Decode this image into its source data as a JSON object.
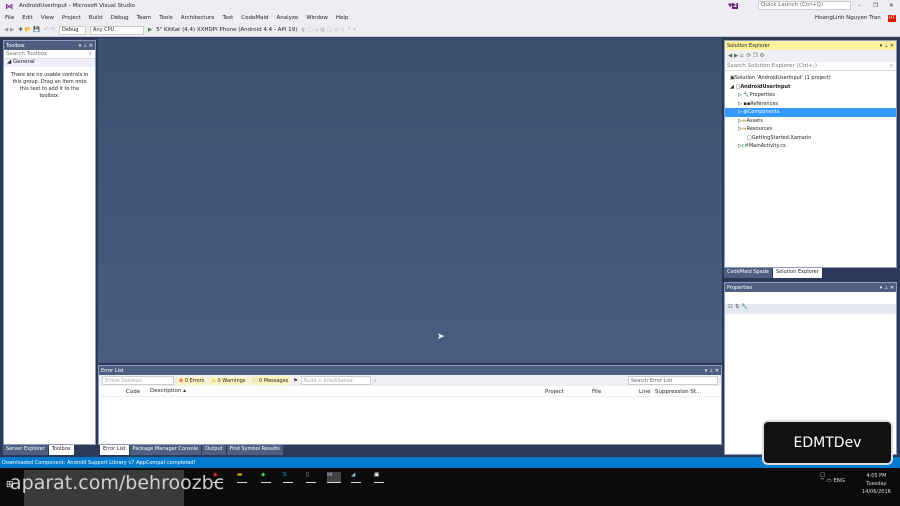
{
  "window": {
    "title": "AndroidUserInput - Microsoft Visual Studio",
    "quick_launch_placeholder": "Quick Launch (Ctrl+Q)",
    "user": "HoangLinh Nguyen Tran",
    "user_initials": "HT",
    "notification_count": "2"
  },
  "menu": [
    "File",
    "Edit",
    "View",
    "Project",
    "Build",
    "Debug",
    "Team",
    "Tools",
    "Architecture",
    "Test",
    "CodeMaid",
    "Analyze",
    "Window",
    "Help"
  ],
  "toolbar": {
    "config": "Debug",
    "platform": "Any CPU",
    "run_target": "5\" KitKat (4.4) XXHDPI Phone (Android 4.4 - API 19)"
  },
  "toolbox": {
    "title": "Toolbox",
    "search_placeholder": "Search Toolbox",
    "group": "General",
    "empty_msg": "There are no usable controls in this group. Drag an item onto this text to add it to the toolbox.",
    "tabs": [
      "Server Explorer",
      "Toolbox"
    ]
  },
  "solution_explorer": {
    "title": "Solution Explorer",
    "search_placeholder": "Search Solution Explorer (Ctrl+;)",
    "solution": "Solution 'AndroidUserInput' (1 project)",
    "project": "AndroidUserInput",
    "items": [
      "Properties",
      "References",
      "Components",
      "Assets",
      "Resources",
      "GettingStarted.Xamarin",
      "MainActivity.cs"
    ],
    "selected": "Components",
    "tabs": [
      "CodeMaid Spade",
      "Solution Explorer"
    ]
  },
  "properties": {
    "title": "Properties"
  },
  "error_list": {
    "title": "Error List",
    "scope": "Entire Solution",
    "errors": "0 Errors",
    "warnings": "0 Warnings",
    "messages": "0 Messages",
    "build_filter": "Build + IntelliSense",
    "search_placeholder": "Search Error List",
    "columns": [
      "Code",
      "Description",
      "Project",
      "File",
      "Line",
      "Suppression St..."
    ],
    "tabs": [
      "Error List",
      "Package Manager Console",
      "Output",
      "Find Symbol Results"
    ]
  },
  "status": "Downloaded Component: Android Support Library v7 AppCompat completed!",
  "taskbar": {
    "time": "4:05 PM",
    "day": "Tuesday",
    "date": "14/06/2016",
    "lang": "ENG"
  },
  "overlay": {
    "badge": "EDMTDev",
    "watermark": "aparat.com/behroozbc"
  },
  "colors": {
    "accent": "#007acc",
    "header": "#4d6082",
    "active_header": "#fff29d",
    "vs_purple": "#68217a"
  }
}
